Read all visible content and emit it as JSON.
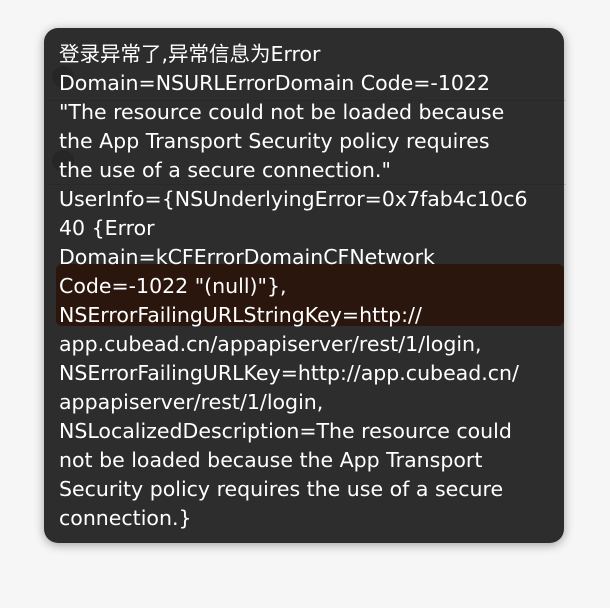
{
  "error_hud": {
    "message": "登录异常了,异常信息为Error\nDomain=NSURLErrorDomain Code=-1022\n\"The resource could not be loaded because\nthe App Transport Security policy requires\nthe use of a secure connection.\"\nUserInfo={NSUnderlyingError=0x7fab4c10c6\n40 {Error\nDomain=kCFErrorDomainCFNetwork\nCode=-1022 \"(null)\"},\nNSErrorFailingURLStringKey=http://\napp.cubead.cn/appapiserver/rest/1/login,\nNSErrorFailingURLKey=http://app.cubead.cn/\nappapiserver/rest/1/login,\nNSLocalizedDescription=The resource could\nnot be loaded because the App Transport\nSecurity policy requires the use of a secure\nconnection.}"
  },
  "colors": {
    "hud_background": "#0c0c0c",
    "hud_text": "#ffffff",
    "login_button": "#e8541e"
  }
}
